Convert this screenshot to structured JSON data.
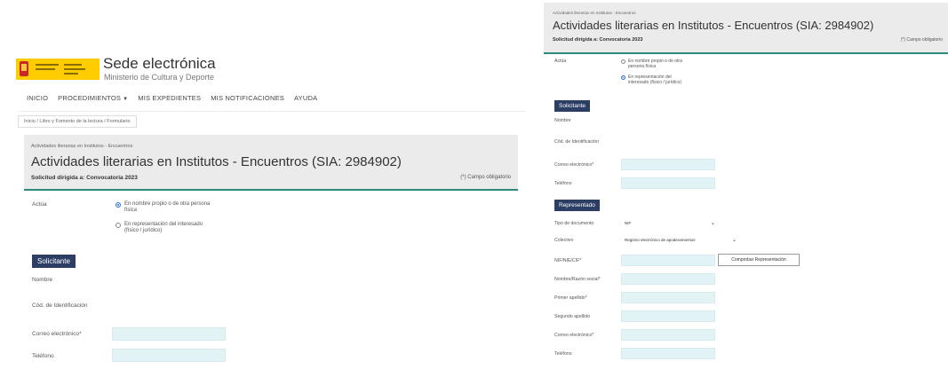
{
  "left": {
    "header": {
      "site_title": "Sede electrónica",
      "site_subtitle": "Ministerio de Cultura y Deporte"
    },
    "nav": [
      "INICIO",
      "PROCEDIMIENTOS",
      "MIS EXPEDIENTES",
      "MIS NOTIFICACIONES",
      "AYUDA"
    ],
    "breadcrumb": "Inicio / Libro y Fomento de la lectura / Formulario",
    "procedure": {
      "kicker": "Actividades literarias en Institutos - Encuentros",
      "title": "Actividades literarias en Institutos - Encuentros (SIA: 2984902)",
      "subtitle": "Solicitud dirigida a: Convocatoria 2023",
      "required_note": "(*) Campo obligatorio"
    },
    "actua": {
      "label": "Actúa",
      "option1": "En nombre propio o de otra persona física",
      "option2": "En representación del interesado (físico / jurídico)",
      "selected": 1
    },
    "solicitante": {
      "section": "Solicitante",
      "nombre": "Nombre",
      "id_doc": "Cód. de Identificación",
      "email": "Correo electrónico*",
      "phone": "Teléfono"
    }
  },
  "right": {
    "procedure": {
      "kicker": "Actividades literarias en Institutos - Encuentros",
      "title": "Actividades literarias en Institutos - Encuentros (SIA: 2984902)",
      "subtitle": "Solicitud dirigida a: Convocatoria 2023",
      "required_note": "(*) Campo obligatorio"
    },
    "actua": {
      "label": "Actúa",
      "option1": "En nombre propio o de otra persona física",
      "option2": "En representación del interesado (físico / jurídico)",
      "selected": 2
    },
    "solicitante": {
      "section": "Solicitante",
      "nombre": "Nombre",
      "id_doc": "Cód. de Identificación",
      "email": "Correo electrónico*",
      "phone": "Teléfono"
    },
    "representado": {
      "section": "Representado",
      "doc_type_label": "Tipo de documento",
      "doc_type_value": "NIF",
      "colectivo_label": "Colectivo",
      "colectivo_value": "Registro electrónico de apoderamientos",
      "nif_label": "NIF/NIE/CIF*",
      "check_button": "Comprobar Representación",
      "name_label": "Nombre/Razón social*",
      "surname1_label": "Primer apellido*",
      "surname2_label": "Segundo apellido",
      "email_label": "Correo electrónico*",
      "phone_label": "Teléfono"
    }
  },
  "colors": {
    "section_header": "#2c3e64",
    "input_bg": "#e2f3f6",
    "accent_line": "#2b8a7a",
    "radio_selected": "#2f6fe0",
    "logo_yellow": "#ffcc00"
  }
}
